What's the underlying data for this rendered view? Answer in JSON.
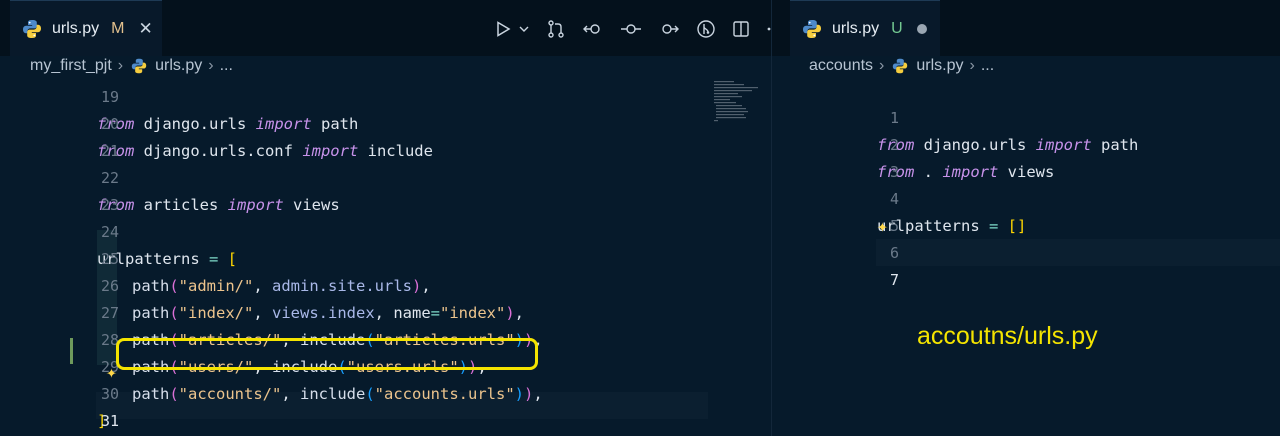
{
  "left_editor": {
    "tab": {
      "filename": "urls.py",
      "status": "M",
      "close": "✕"
    },
    "breadcrumb": {
      "folder": "my_first_pjt",
      "file": "urls.py",
      "more": "..."
    },
    "lines": [
      {
        "n": "19"
      },
      {
        "n": "20"
      },
      {
        "n": "21"
      },
      {
        "n": "22"
      },
      {
        "n": "23"
      },
      {
        "n": "24"
      },
      {
        "n": "25"
      },
      {
        "n": "26"
      },
      {
        "n": "27"
      },
      {
        "n": "28"
      },
      {
        "n": "29"
      },
      {
        "n": "30"
      },
      {
        "n": "31"
      }
    ],
    "code": {
      "l19": {
        "k1": "from",
        "t1": " django.urls ",
        "k2": "import",
        "t2": " path"
      },
      "l20": {
        "k1": "from",
        "t1": " django.urls.conf ",
        "k2": "import",
        "t2": " include"
      },
      "l22": {
        "k1": "from",
        "t1": " articles ",
        "k2": "import",
        "t2": " views"
      },
      "l24": {
        "t1": "urlpatterns",
        "op": " = ",
        "b": "["
      },
      "l25": {
        "fn": "path",
        "b1": "(",
        "s1": "\"admin/\"",
        "c": ", ",
        "a": "admin.site.urls",
        "b2": ")",
        "e": ","
      },
      "l26": {
        "fn": "path",
        "b1": "(",
        "s1": "\"index/\"",
        "c": ", ",
        "a": "views.index",
        "c2": ", ",
        "kw": "name",
        "op": "=",
        "s2": "\"index\"",
        "b2": ")",
        "e": ","
      },
      "l27": {
        "fn": "path",
        "b1": "(",
        "s1": "\"articles/\"",
        "c": ", ",
        "inc": "include",
        "b3": "(",
        "s2": "\"articles.urls\"",
        "b4": ")",
        "b2": ")",
        "e": ","
      },
      "l28": {
        "fn": "path",
        "b1": "(",
        "s1": "\"users/\"",
        "c": ", ",
        "inc": "include",
        "b3": "(",
        "s2": "\"users.urls\"",
        "b4": ")",
        "b2": ")",
        "e": ","
      },
      "l29": {
        "fn": "path",
        "b1": "(",
        "s1": "\"accounts/\"",
        "c": ", ",
        "inc": "include",
        "b3": "(",
        "s2": "\"accounts.urls\"",
        "b4": ")",
        "b2": ")",
        "e": ","
      },
      "l30": {
        "b": "]"
      }
    }
  },
  "right_editor": {
    "tab": {
      "filename": "urls.py",
      "status": "U"
    },
    "breadcrumb": {
      "folder": "accounts",
      "file": "urls.py",
      "more": "..."
    },
    "lines": [
      {
        "n": "1"
      },
      {
        "n": "2"
      },
      {
        "n": "3"
      },
      {
        "n": "4"
      },
      {
        "n": "5"
      },
      {
        "n": "6"
      },
      {
        "n": "7"
      }
    ],
    "code": {
      "l1": {
        "k1": "from",
        "t1": " django.urls ",
        "k2": "import",
        "t2": " path"
      },
      "l2": {
        "k1": "from",
        "t1": " . ",
        "k2": "import",
        "t2": " views"
      },
      "l4": {
        "t1": "urlpatterns",
        "op": " = ",
        "b": "[]"
      }
    }
  },
  "annotation": "accoutns/urls.py",
  "icons": [
    "python-file-icon",
    "run-icon",
    "chevron-down-icon",
    "source-control-icon",
    "go-back-icon",
    "commit-icon",
    "go-forward-icon",
    "merge-icon",
    "split-editor-icon",
    "more-actions-icon",
    "sparkle-icon",
    "dirty-dot-icon"
  ],
  "colors": {
    "accent_yellow": "#f4e400",
    "keyword": "#c792ea",
    "string": "#ecc48d",
    "modified": "#e2c08d",
    "untracked": "#73c991"
  }
}
